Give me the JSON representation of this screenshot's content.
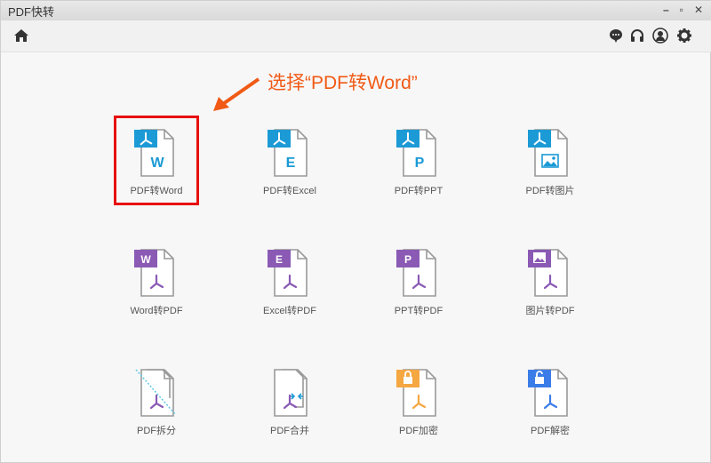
{
  "window": {
    "title": "PDF快转",
    "minimize": "–",
    "maximize": "▫",
    "close": "✕"
  },
  "toolbar": {
    "left": [
      "home-icon"
    ],
    "right": [
      "chat-icon",
      "headset-icon",
      "user-icon",
      "gear-icon"
    ]
  },
  "annotation": {
    "text": "选择“PDF转Word”",
    "color": "#f05a16"
  },
  "colors": {
    "blue": "#1b9ad6",
    "purple": "#8a5ab4",
    "orange": "#f5a742",
    "lockblue": "#3b7de8"
  },
  "items": [
    {
      "label": "PDF转Word",
      "tab": "pdf",
      "tabColor": "#1b9ad6",
      "body": "W",
      "bodyColor": "#1b9ad6"
    },
    {
      "label": "PDF转Excel",
      "tab": "pdf",
      "tabColor": "#1b9ad6",
      "body": "E",
      "bodyColor": "#1b9ad6"
    },
    {
      "label": "PDF转PPT",
      "tab": "pdf",
      "tabColor": "#1b9ad6",
      "body": "P",
      "bodyColor": "#1b9ad6"
    },
    {
      "label": "PDF转图片",
      "tab": "pdf",
      "tabColor": "#1b9ad6",
      "body": "image",
      "bodyColor": "#1b9ad6"
    },
    {
      "label": "Word转PDF",
      "tab": "W",
      "tabColor": "#8a5ab4",
      "body": "pdf",
      "bodyColor": "#8a5ab4"
    },
    {
      "label": "Excel转PDF",
      "tab": "E",
      "tabColor": "#8a5ab4",
      "body": "pdf",
      "bodyColor": "#8a5ab4"
    },
    {
      "label": "PPT转PDF",
      "tab": "P",
      "tabColor": "#8a5ab4",
      "body": "pdf",
      "bodyColor": "#8a5ab4"
    },
    {
      "label": "图片转PDF",
      "tab": "image",
      "tabColor": "#8a5ab4",
      "body": "pdf",
      "bodyColor": "#8a5ab4"
    },
    {
      "label": "PDF拆分",
      "tab": "split",
      "tabColor": "#5ec8e6",
      "body": "pdf",
      "bodyColor": "#8a5ab4"
    },
    {
      "label": "PDF合并",
      "tab": "merge",
      "tabColor": "#1b9ad6",
      "body": "pdf",
      "bodyColor": "#8a5ab4"
    },
    {
      "label": "PDF加密",
      "tab": "lock",
      "tabColor": "#f5a742",
      "body": "pdf",
      "bodyColor": "#f5a742"
    },
    {
      "label": "PDF解密",
      "tab": "unlock",
      "tabColor": "#3b7de8",
      "body": "pdf",
      "bodyColor": "#3b7de8"
    }
  ]
}
